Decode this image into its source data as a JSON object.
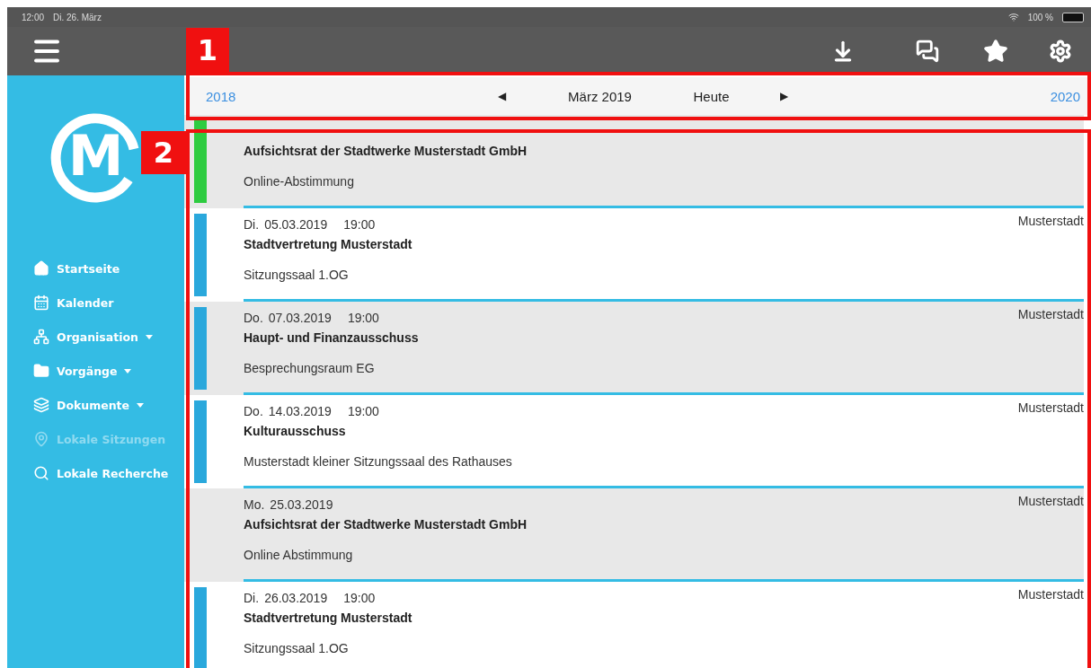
{
  "status_bar": {
    "time": "12:00",
    "date": "Di. 26. März",
    "battery": "100 %"
  },
  "logo": {
    "letter": "M"
  },
  "sidebar": {
    "items": [
      {
        "label": "Startseite",
        "has_menu": false,
        "disabled": false
      },
      {
        "label": "Kalender",
        "has_menu": false,
        "disabled": false
      },
      {
        "label": "Organisation",
        "has_menu": true,
        "disabled": false
      },
      {
        "label": "Vorgänge",
        "has_menu": true,
        "disabled": false
      },
      {
        "label": "Dokumente",
        "has_menu": true,
        "disabled": false
      },
      {
        "label": "Lokale Sitzungen",
        "has_menu": false,
        "disabled": true
      },
      {
        "label": "Lokale Recherche",
        "has_menu": false,
        "disabled": false
      }
    ]
  },
  "calendar_nav": {
    "prev_year": "2018",
    "prev": "◀",
    "month": "März 2019",
    "today": "Heute",
    "next": "▶",
    "next_year": "2020"
  },
  "meetings": [
    {
      "title": "Aufsichtsrat der Stadtwerke Musterstadt GmbH",
      "location": "Online-Abstimmung",
      "color": "#2ecc40"
    },
    {
      "date": "Di.",
      "day": "05.03.2019",
      "time": "19:00",
      "title": "Stadtvertretung Musterstadt",
      "location": "Sitzungssaal 1.OG",
      "place": "Musterstadt",
      "color": "#2aa8dc"
    },
    {
      "date": "Do.",
      "day": "07.03.2019",
      "time": "19:00",
      "title": "Haupt- und Finanzausschuss",
      "location": "Besprechungsraum EG",
      "place": "Musterstadt",
      "color": "#2aa8dc"
    },
    {
      "date": "Do.",
      "day": "14.03.2019",
      "time": "19:00",
      "title": "Kulturausschuss",
      "location": "Musterstadt kleiner Sitzungssaal des Rathauses",
      "place": "Musterstadt",
      "color": "#2aa8dc"
    },
    {
      "date": "Mo.",
      "day": "25.03.2019",
      "title": "Aufsichtsrat der Stadtwerke Musterstadt GmbH",
      "location": "Online Abstimmung",
      "place": "Musterstadt"
    },
    {
      "date": "Di.",
      "day": "26.03.2019",
      "time": "19:00",
      "title": "Stadtvertretung Musterstadt",
      "location": "Sitzungssaal 1.OG",
      "place": "Musterstadt",
      "color": "#2aa8dc"
    }
  ],
  "annotations": [
    {
      "label": "1"
    },
    {
      "label": "2"
    }
  ]
}
